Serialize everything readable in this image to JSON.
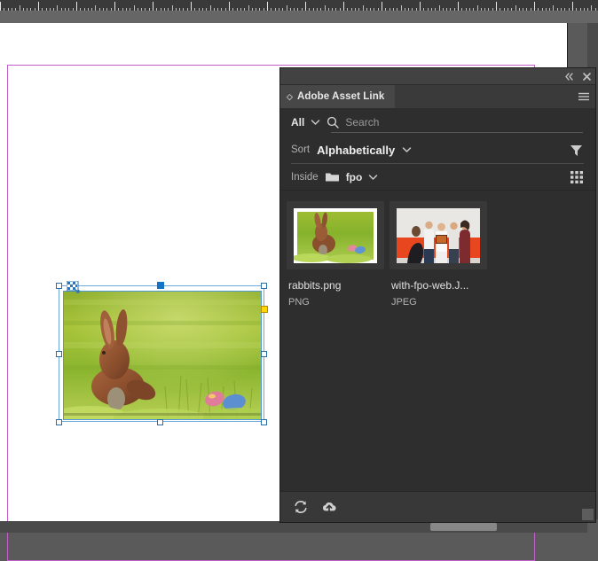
{
  "app": {
    "canvas_background": "#5a5a5a",
    "page_background": "#ffffff",
    "margin_guide_color": "#c060c8"
  },
  "document": {
    "selected_frame": {
      "name": "rabbits image frame",
      "alt": "Chocolate bunny rabbits on green grass with easter eggs",
      "handles": [
        "top-left",
        "top-center",
        "top-right",
        "middle-left",
        "middle-right",
        "bottom-left",
        "bottom-center",
        "bottom-right"
      ],
      "active_handle": "top-center",
      "corner_effects_handle_color": "#ffd400",
      "selection_color": "#6fa8dc"
    }
  },
  "panel": {
    "title": "Adobe Asset Link",
    "collapse_label": "Collapse to Icons",
    "close_label": "Close",
    "menu_label": "Panel Menu",
    "filter": {
      "selected": "All",
      "chevron_icon": "chevron-down-icon"
    },
    "search": {
      "placeholder": "Search",
      "value": "",
      "icon": "search-icon"
    },
    "sort": {
      "label": "Sort",
      "selected": "Alphabetically",
      "chevron_icon": "chevron-down-icon",
      "filter_icon": "funnel-filter-icon"
    },
    "breadcrumb": {
      "label": "Inside",
      "folder_icon": "folder-icon",
      "folder_name": "fpo",
      "chevron_icon": "chevron-down-icon",
      "view_toggle_icon": "grid-view-icon"
    },
    "assets": [
      {
        "name": "rabbits.png",
        "type": "PNG",
        "thumb": "chocolate-bunny-on-grass"
      },
      {
        "name": "with-fpo-web.J...",
        "type": "JPEG",
        "thumb": "group-of-people-orange-wall"
      }
    ],
    "footer": {
      "refresh_label": "Refresh",
      "refresh_icon": "refresh-icon",
      "upload_label": "Upload to Cloud",
      "upload_icon": "cloud-upload-icon"
    }
  }
}
